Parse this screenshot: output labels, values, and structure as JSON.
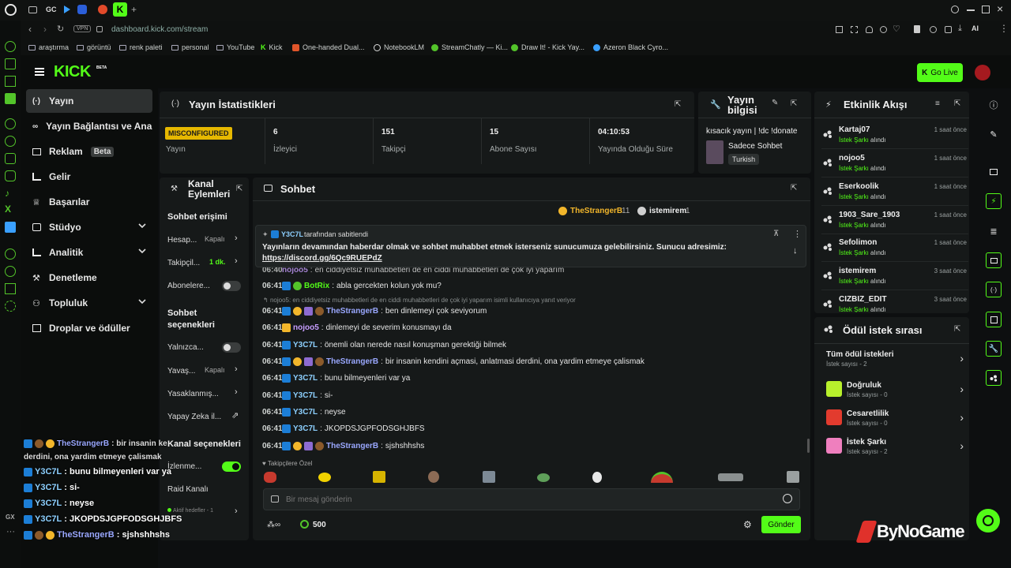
{
  "browser": {
    "tabs": [
      "GC"
    ],
    "url": "dashboard.kick.com/stream",
    "vpn": "VPN",
    "ai": "AI",
    "bookmarks": [
      "araştırma",
      "görüntü",
      "renk paleti",
      "personal",
      "YouTube",
      "Kick",
      "One-handed Dual...",
      "NotebookLM",
      "StreamChatly — Ki...",
      "Draw It! - Kick Yay...",
      "Azeron Black Cyro..."
    ],
    "rail_bottom": "GX"
  },
  "kick": {
    "logo": "KICK",
    "logo_badge": "BETA",
    "go_live": "Go Live"
  },
  "sidebar": {
    "items": [
      {
        "label": "Yayın",
        "icon": "broadcast-icon"
      },
      {
        "label": "Yayın Bağlantısı ve Anahtarı",
        "icon": "link-icon"
      },
      {
        "label": "Reklam",
        "icon": "ad-icon",
        "badge": "Beta"
      },
      {
        "label": "Gelir",
        "icon": "chart-icon"
      },
      {
        "label": "Başarılar",
        "icon": "trophy-icon"
      },
      {
        "label": "Stüdyo",
        "icon": "studio-icon"
      },
      {
        "label": "Analitik",
        "icon": "analytics-icon"
      },
      {
        "label": "Denetleme",
        "icon": "hammer-icon"
      },
      {
        "label": "Topluluk",
        "icon": "community-icon"
      },
      {
        "label": "Droplar ve ödüller",
        "icon": "gift-icon"
      }
    ]
  },
  "stats": {
    "title": "Yayın İstatistikleri",
    "status_badge": "MISCONFIGURED",
    "status_label": "Yayın",
    "cells": [
      {
        "value": "6",
        "label": "İzleyici"
      },
      {
        "value": "151",
        "label": "Takipçi"
      },
      {
        "value": "15",
        "label": "Abone Sayısı"
      },
      {
        "value": "04:10:53",
        "label": "Yayında Olduğu Süre"
      }
    ]
  },
  "stream_info": {
    "title_line1": "Yayın",
    "title_line2": "bilgisi",
    "stream_title": "kısacık yayın | !dc !donate",
    "category": "Sadece Sohbet",
    "language": "Turkish"
  },
  "channel_actions": {
    "title_line1": "Kanal",
    "title_line2": "Eylemleri",
    "chat_access": "Sohbet erişimi",
    "rows1": [
      {
        "label": "Hesap...",
        "value": "Kapalı"
      },
      {
        "label": "Takipçil...",
        "value": "1 dk."
      },
      {
        "label": "Abonelere..."
      }
    ],
    "chat_options_line1": "Sohbet",
    "chat_options_line2": "seçenekleri",
    "rows2": [
      {
        "label": "Yalnızca..."
      },
      {
        "label": "Yavaş...",
        "value": "Kapalı"
      },
      {
        "label": "Yasaklanmış..."
      },
      {
        "label": "Yapay Zeka il..."
      }
    ],
    "channel_options": "Kanal seçenekleri",
    "rows3": [
      {
        "label": "İzlenme..."
      },
      {
        "label": "Raid Kanalı"
      },
      {
        "label": "Aktif hedefler - 1"
      }
    ]
  },
  "chat": {
    "title": "Sohbet",
    "top_users": [
      {
        "name": "TheStrangerB",
        "count": "11"
      },
      {
        "name": "istemirem",
        "count": "1"
      }
    ],
    "pinned_by_user": "Y3C7L",
    "pinned_by_text": "tarafından sabitlendi",
    "pinned_message": "Yayınların devamından haberdar olmak ve sohbet muhabbet etmek isterseniz sunucumuza gelebilirsiniz. Sunucu adresimiz:",
    "pinned_link": "https://discord.gg/6Qc9RUEPdZ",
    "partial_time": "06:40",
    "partial_user": "nojoo5",
    "partial_text": "en ciddiyetsiz muhabbetleri de en ciddi muhabbetleri de çok iyi yaparım",
    "reply_note": "nojoo5: en ciddiyetsiz muhabbetleri de en ciddi muhabbetleri de çok iyi yaparım isimli kullanıcıya yanıt veriyor",
    "messages": [
      {
        "time": "06:41",
        "user": "BotRix",
        "text": "abla gercekten kolun yok mu?"
      },
      {
        "time": "06:41",
        "user": "TheStrangerB",
        "text": "ben dinlemeyi çok seviyorum"
      },
      {
        "time": "06:41",
        "user": "nojoo5",
        "text": "dinlemeyi de severim konusmayı da"
      },
      {
        "time": "06:41",
        "user": "Y3C7L",
        "text": "önemli olan nerede nasıl konuşman gerektiği bilmek"
      },
      {
        "time": "06:41",
        "user": "TheStrangerB",
        "text": "bir insanin kendini açmasi, anlatmasi derdini, ona yardim etmeye çalismak"
      },
      {
        "time": "06:41",
        "user": "Y3C7L",
        "text": "bunu bilmeyenleri var ya"
      },
      {
        "time": "06:41",
        "user": "Y3C7L",
        "text": "si-"
      },
      {
        "time": "06:41",
        "user": "Y3C7L",
        "text": "neyse"
      },
      {
        "time": "06:41",
        "user": "Y3C7L",
        "text": "JKOPDSJGPFODSGHJBFS"
      },
      {
        "time": "06:41",
        "user": "TheStrangerB",
        "text": "sjshshhshs"
      }
    ],
    "emote_section": "Takipçilere Özel",
    "input_placeholder": "Bir mesaj gönderin",
    "points": "500",
    "send": "Gönder"
  },
  "events": {
    "title": "Etkinlik Akışı",
    "items": [
      {
        "name": "Kartaj07",
        "action": "İstek Şarkı",
        "suffix": "alındı",
        "time": "1 saat önce"
      },
      {
        "name": "nojoo5",
        "action": "İstek Şarkı",
        "suffix": "alındı",
        "time": "1 saat önce"
      },
      {
        "name": "Eserkoolik",
        "action": "İstek Şarkı",
        "suffix": "alındı",
        "time": "1 saat önce"
      },
      {
        "name": "1903_Sare_1903",
        "action": "İstek Şarkı",
        "suffix": "alındı",
        "time": "1 saat önce"
      },
      {
        "name": "Sefolimon",
        "action": "İstek Şarkı",
        "suffix": "alındı",
        "time": "1 saat önce"
      },
      {
        "name": "istemirem",
        "action": "İstek Şarkı",
        "suffix": "alındı",
        "time": "3 saat önce"
      },
      {
        "name": "CIZBIZ_EDIT",
        "action": "İstek Şarkı",
        "suffix": "alındı",
        "time": "3 saat önce"
      }
    ]
  },
  "rewards": {
    "title": "Ödül istek sırası",
    "all_title": "Tüm ödül istekleri",
    "all_sub": "İstek sayısı - 2",
    "items": [
      {
        "name": "Doğruluk",
        "sub": "İstek sayısı - 0",
        "color": "#b8f02c"
      },
      {
        "name": "Cesaretlilik",
        "sub": "İstek sayısı - 0",
        "color": "#e23b2e"
      },
      {
        "name": "İstek Şarkı",
        "sub": "İstek sayısı - 2",
        "color": "#ef7fbe"
      }
    ]
  },
  "overlay_chat": [
    {
      "user": "TheStrangerB",
      "text": ": bir insanin ke",
      "line2": "derdini, ona yardim etmeye çalismak"
    },
    {
      "user": "Y3C7L",
      "text": ": bunu bilmeyenleri var ya"
    },
    {
      "user": "Y3C7L",
      "text": ": si-"
    },
    {
      "user": "Y3C7L",
      "text": ": neyse"
    },
    {
      "user": "Y3C7L",
      "text": ": JKOPDSJGPFODSGHJBFS"
    },
    {
      "user": "TheStrangerB",
      "text": ": sjshshhshs"
    }
  ],
  "watermark": "ByNoGame",
  "colors": {
    "accent": "#53fc18",
    "panel": "#161919",
    "bg": "#0d0f10"
  }
}
